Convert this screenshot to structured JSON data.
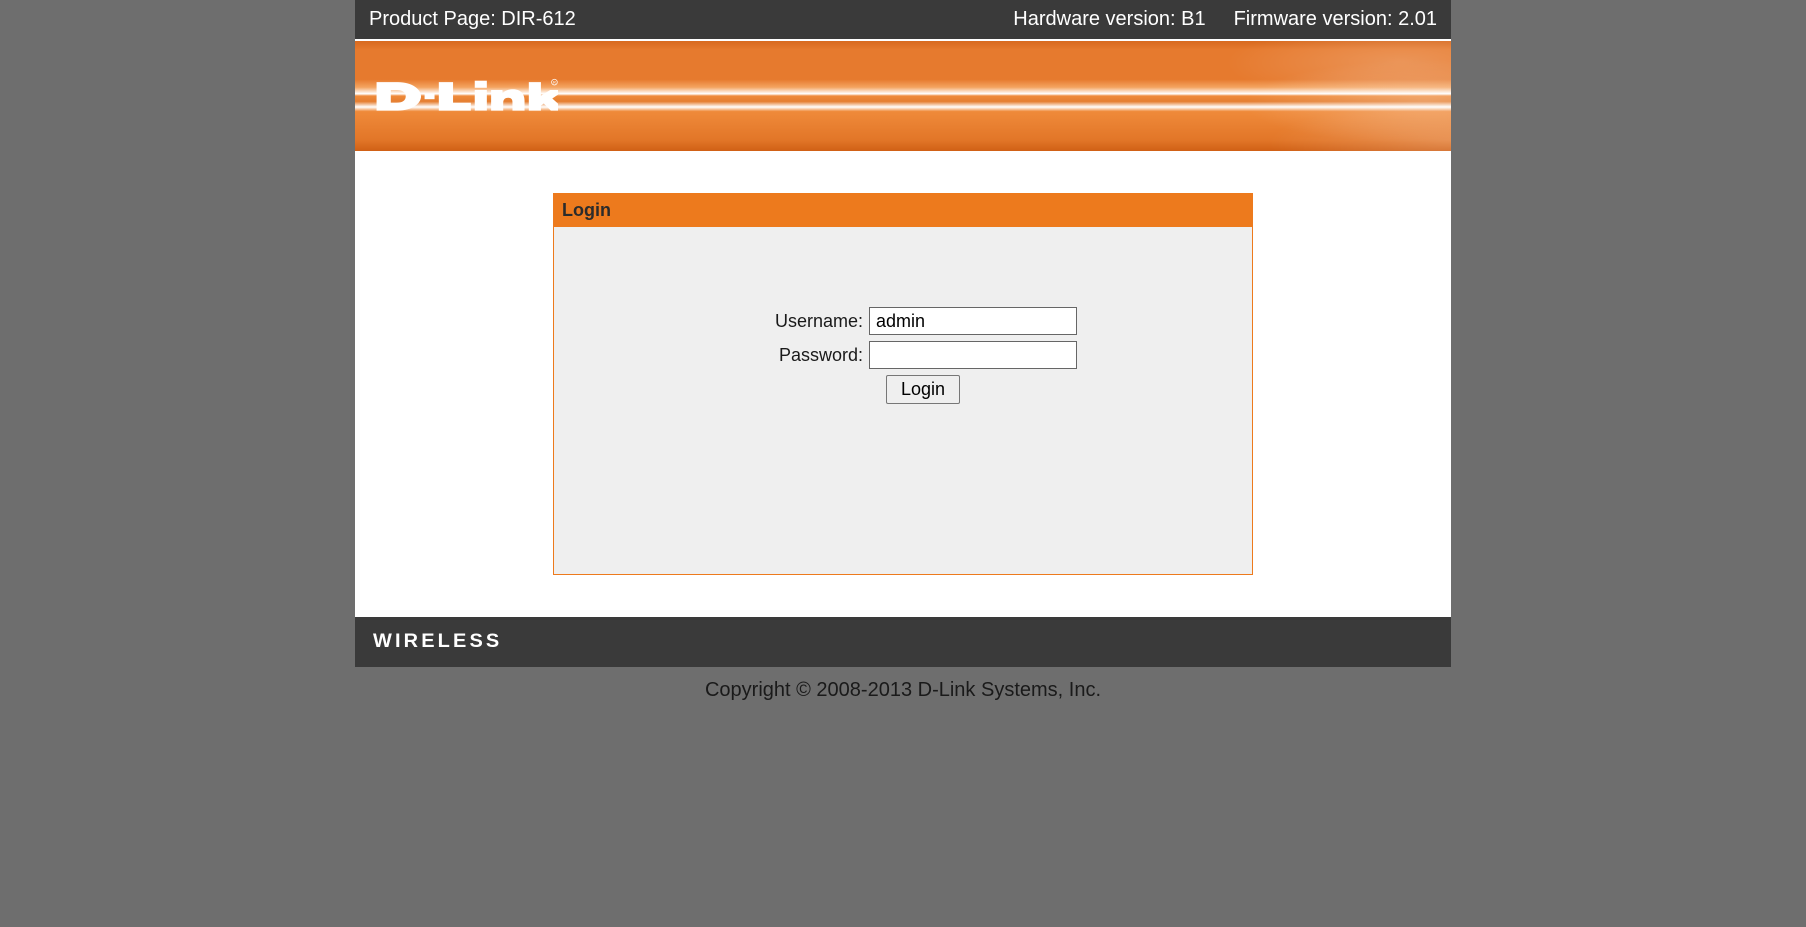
{
  "topbar": {
    "product_label": "Product Page: DIR-612",
    "hardware_label": "Hardware version: B1",
    "firmware_label": "Firmware version: 2.01"
  },
  "brand": {
    "logo_text": "D-Link"
  },
  "login": {
    "panel_title": "Login",
    "username_label": "Username:",
    "username_value": "admin",
    "password_label": "Password:",
    "password_value": "",
    "button_label": "Login"
  },
  "footer": {
    "wireless_text": "WIRELESS",
    "copyright": "Copyright © 2008-2013 D-Link Systems, Inc."
  }
}
